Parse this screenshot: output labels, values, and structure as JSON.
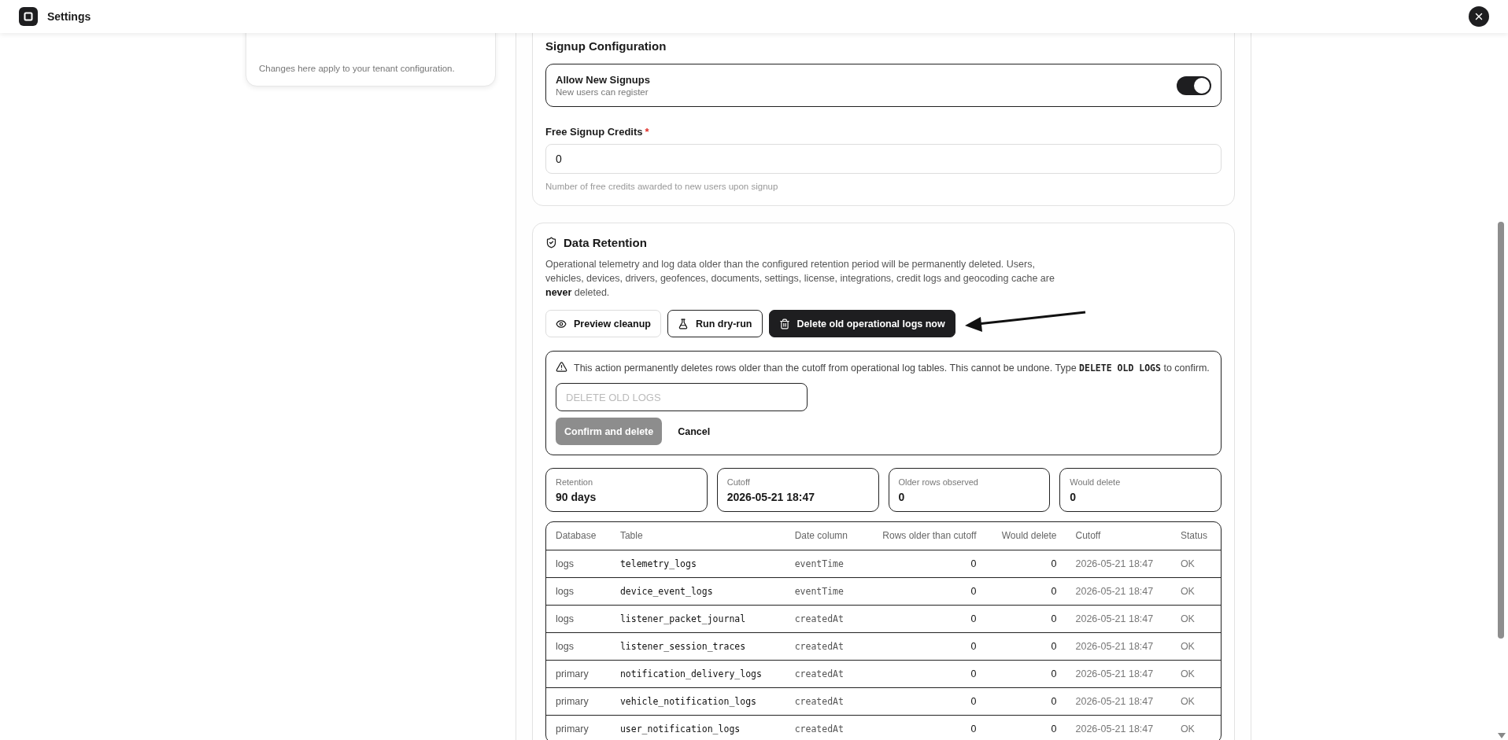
{
  "header": {
    "title": "Settings"
  },
  "left_card": {
    "note": "Changes here apply to your tenant configuration."
  },
  "signup": {
    "title": "Signup Configuration",
    "toggle": {
      "label": "Allow New Signups",
      "description": "New users can register",
      "on": true
    },
    "credits": {
      "label": "Free Signup Credits",
      "required": true,
      "required_mark": "*",
      "value": "0",
      "help": "Number of free credits awarded to new users upon signup"
    }
  },
  "retention": {
    "title": "Data Retention",
    "description": "Operational telemetry and log data older than the configured retention period will be permanently deleted. Users, vehicles, devices, drivers, geofences, documents, settings, license, integrations, credit logs and geocoding cache are **never** deleted.",
    "buttons": [
      {
        "label": "Preview cleanup",
        "kind": "outline"
      },
      {
        "label": "Run dry-run",
        "kind": "outline"
      },
      {
        "label": "Delete old operational logs now",
        "kind": "dark"
      }
    ],
    "confirm": {
      "text_before": "This action permanently deletes rows older than the cutoff from operational log tables. This cannot be undone. Type",
      "code": "DELETE OLD LOGS",
      "text_after": "to confirm.",
      "placeholder": "DELETE OLD LOGS",
      "confirm_button": {
        "label": "Confirm and delete",
        "disabled": true
      },
      "cancel_button": {
        "label": "Cancel"
      }
    },
    "stats": [
      {
        "label": "Retention",
        "value": "90 days"
      },
      {
        "label": "Cutoff",
        "value": "2026-05-21 18:47"
      },
      {
        "label": "Older rows observed",
        "value": "0"
      },
      {
        "label": "Would delete",
        "value": "0"
      }
    ],
    "table": {
      "columns": [
        "Database",
        "Table",
        "Date column",
        "Rows older than cutoff",
        "Would delete",
        "Cutoff",
        "Status"
      ],
      "rows": [
        [
          "logs",
          "telemetry_logs",
          "eventTime",
          "0",
          "0",
          "2026-05-21 18:47",
          "OK"
        ],
        [
          "logs",
          "device_event_logs",
          "eventTime",
          "0",
          "0",
          "2026-05-21 18:47",
          "OK"
        ],
        [
          "logs",
          "listener_packet_journal",
          "createdAt",
          "0",
          "0",
          "2026-05-21 18:47",
          "OK"
        ],
        [
          "logs",
          "listener_session_traces",
          "createdAt",
          "0",
          "0",
          "2026-05-21 18:47",
          "OK"
        ],
        [
          "primary",
          "notification_delivery_logs",
          "createdAt",
          "0",
          "0",
          "2026-05-21 18:47",
          "OK"
        ],
        [
          "primary",
          "vehicle_notification_logs",
          "createdAt",
          "0",
          "0",
          "2026-05-21 18:47",
          "OK"
        ],
        [
          "primary",
          "user_notification_logs",
          "createdAt",
          "0",
          "0",
          "2026-05-21 18:47",
          "OK"
        ]
      ]
    }
  }
}
